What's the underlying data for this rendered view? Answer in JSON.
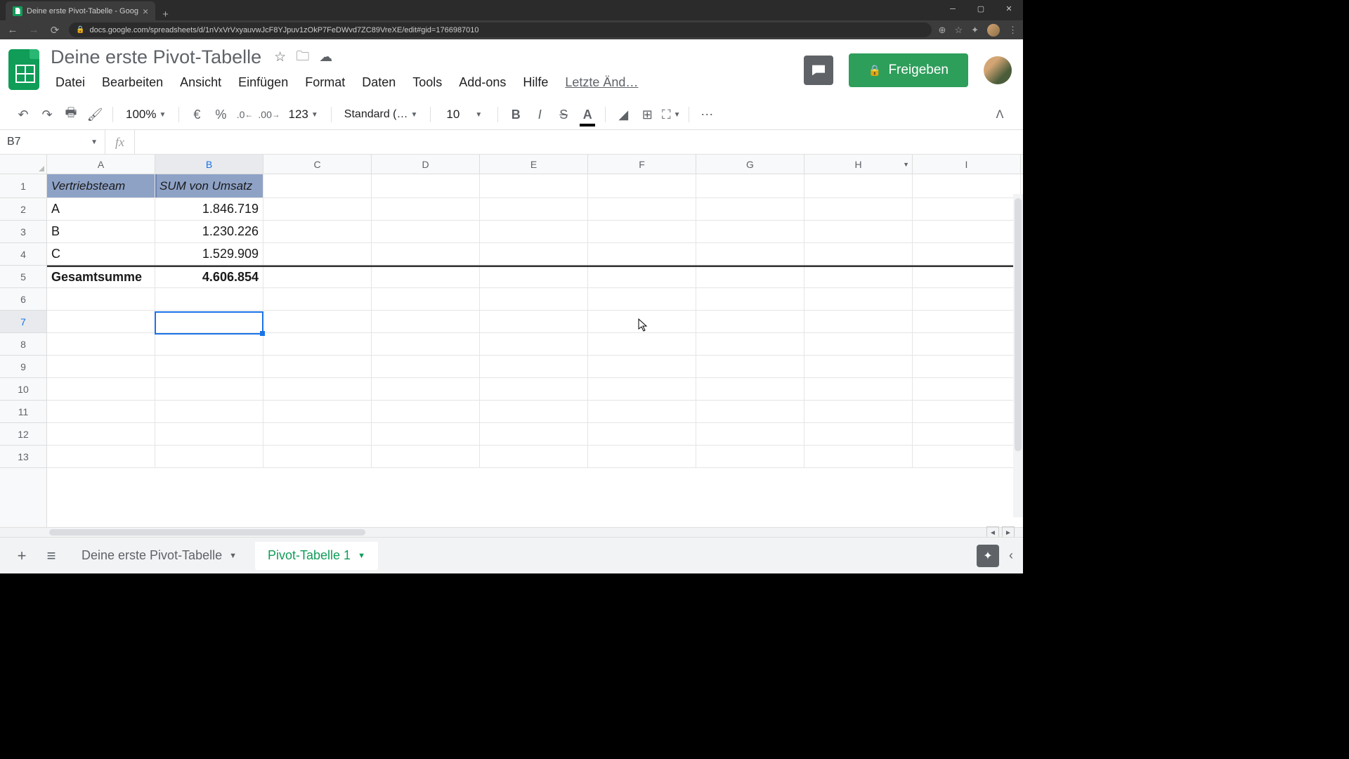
{
  "browser": {
    "tab_title": "Deine erste Pivot-Tabelle - Goog",
    "url": "docs.google.com/spreadsheets/d/1nVxVrVxyauvwJcF8YJpuv1zOkP7FeDWvd7ZC89VreXE/edit#gid=1766987010"
  },
  "doc": {
    "title": "Deine erste Pivot-Tabelle",
    "menus": [
      "Datei",
      "Bearbeiten",
      "Ansicht",
      "Einfügen",
      "Format",
      "Daten",
      "Tools",
      "Add-ons",
      "Hilfe"
    ],
    "last_edit": "Letzte Änd…",
    "share_label": "Freigeben"
  },
  "toolbar": {
    "zoom": "100%",
    "currency": "€",
    "percent": "%",
    "dec_less": ".0",
    "dec_more": ".00",
    "num_format": "123",
    "font": "Standard (…",
    "size": "10"
  },
  "namebox": {
    "cell": "B7"
  },
  "columns": [
    "A",
    "B",
    "C",
    "D",
    "E",
    "F",
    "G",
    "H",
    "I"
  ],
  "rows": [
    "1",
    "2",
    "3",
    "4",
    "5",
    "6",
    "7",
    "8",
    "9",
    "10",
    "11",
    "12",
    "13"
  ],
  "pivot": {
    "header_a": "Vertriebsteam",
    "header_b": "SUM von Umsatz",
    "data": [
      {
        "team": "A",
        "value": "1.846.719"
      },
      {
        "team": "B",
        "value": "1.230.226"
      },
      {
        "team": "C",
        "value": "1.529.909"
      }
    ],
    "total_label": "Gesamtsumme",
    "total_value": "4.606.854"
  },
  "sheets": {
    "tab1": "Deine erste Pivot-Tabelle",
    "tab2": "Pivot-Tabelle 1"
  },
  "active_cell": "B7"
}
